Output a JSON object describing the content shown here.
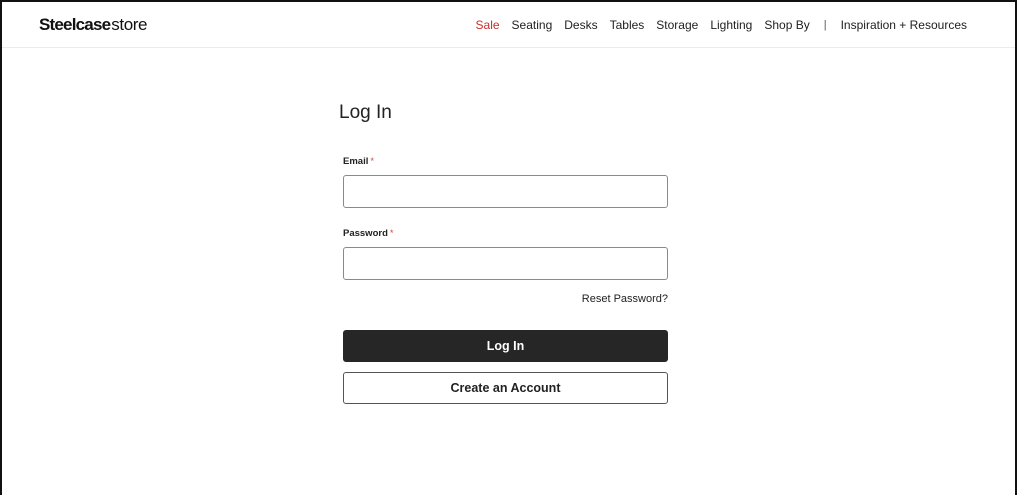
{
  "header": {
    "logo_brand": "Steelcase",
    "logo_suffix": "store",
    "nav": [
      {
        "label": "Sale"
      },
      {
        "label": "Seating"
      },
      {
        "label": "Desks"
      },
      {
        "label": "Tables"
      },
      {
        "label": "Storage"
      },
      {
        "label": "Lighting"
      },
      {
        "label": "Shop By"
      },
      {
        "label": "|"
      },
      {
        "label": "Inspiration + Resources"
      }
    ]
  },
  "login": {
    "title": "Log In",
    "email_label": "Email",
    "email_value": "",
    "password_label": "Password",
    "password_value": "",
    "required_mark": "*",
    "reset_link": "Reset Password?",
    "login_button": "Log In",
    "create_account_button": "Create an Account"
  },
  "colors": {
    "sale": "#c4302b",
    "primary_button": "#262626",
    "required": "#d04a46"
  }
}
